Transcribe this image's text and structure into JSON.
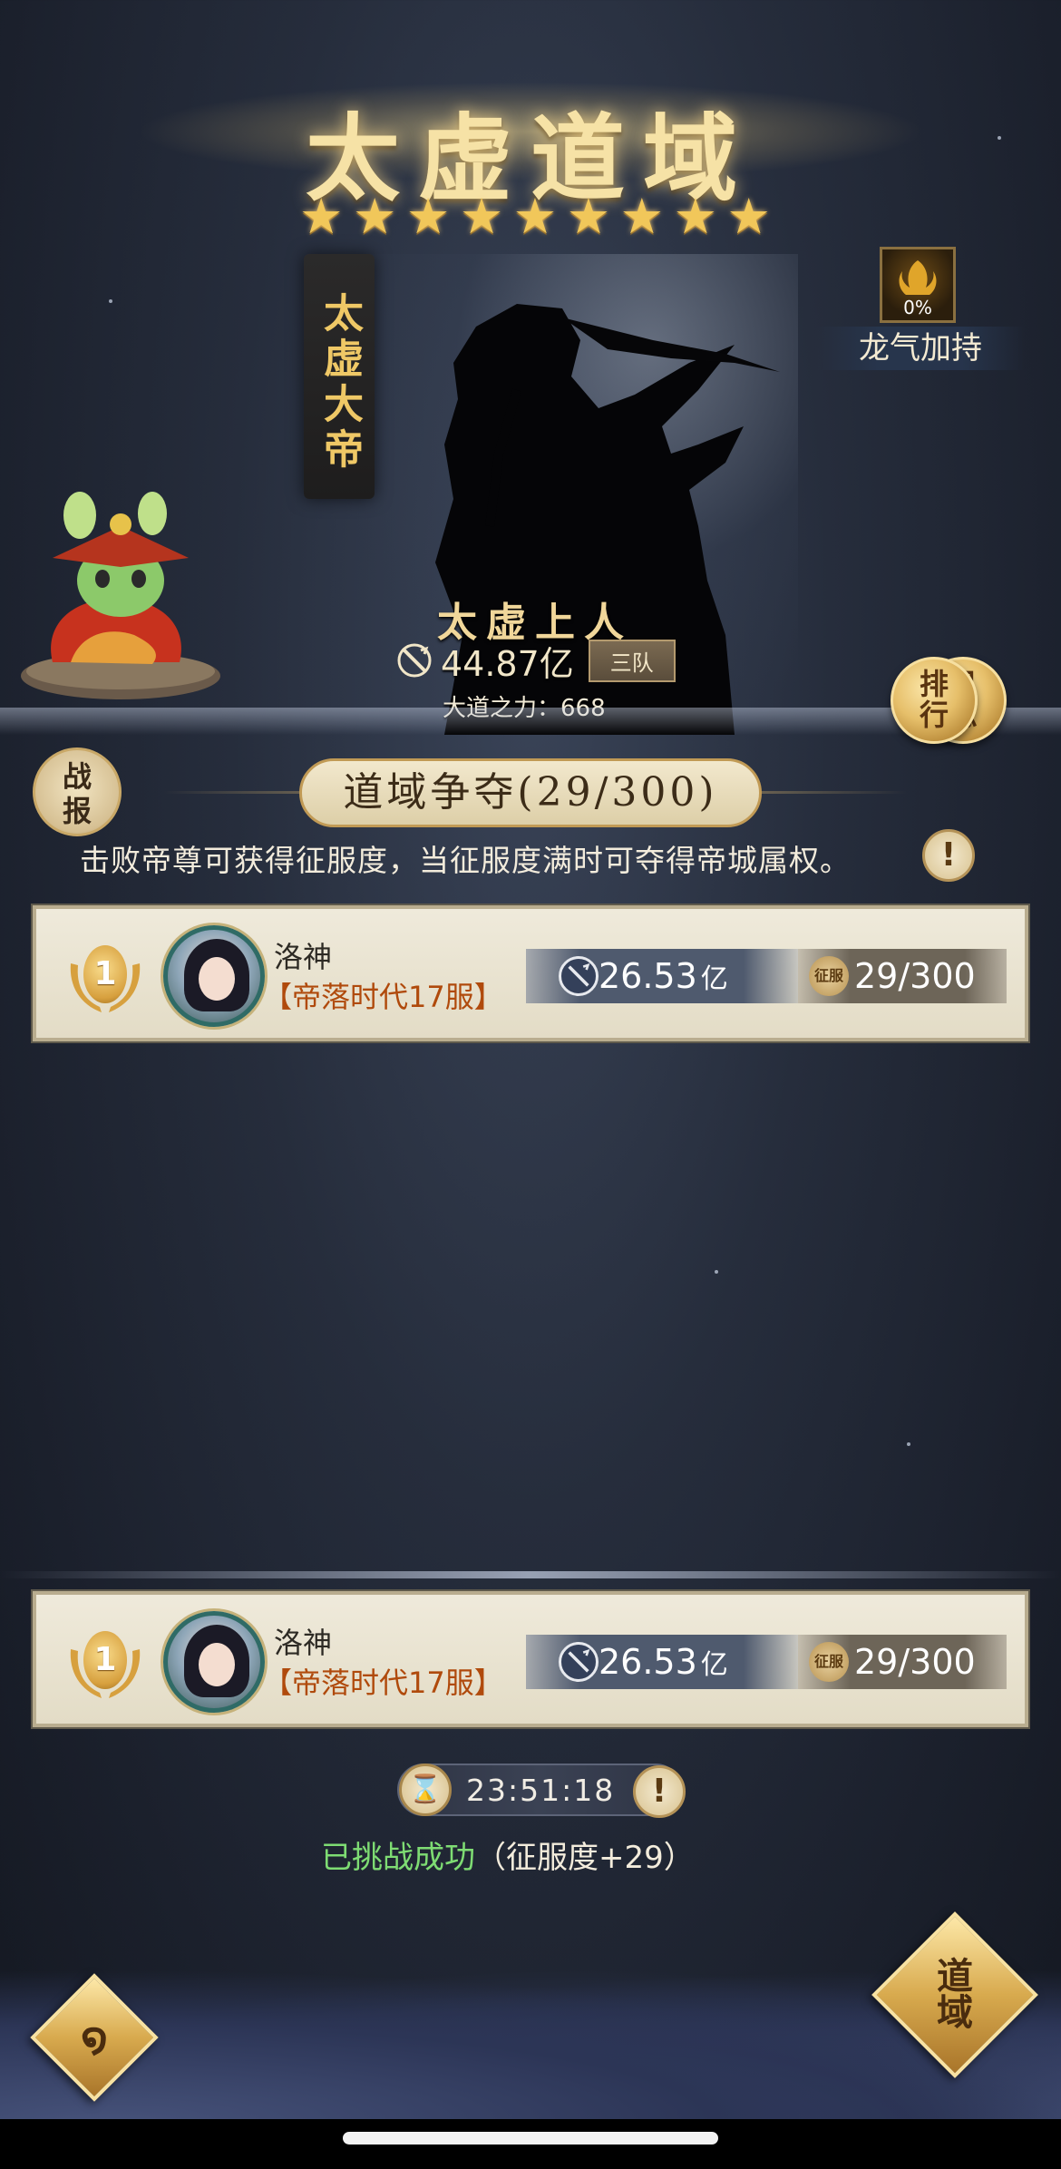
{
  "title": "太虚道域",
  "stars_count": 9,
  "banner_title": "太虚大帝",
  "hero": {
    "name": "太虚上人",
    "power": "44.87亿",
    "team": "三队",
    "dao_power_label": "大道之力：",
    "dao_power_value": "668"
  },
  "buff": {
    "percent": "0%",
    "label": "龙气加持"
  },
  "buttons": {
    "ranking": "排行",
    "log": "日志",
    "battle_report": "战报",
    "dao_domain": "道域"
  },
  "contest": {
    "title": "道域争夺(29/300)",
    "description": "击败帝尊可获得征服度，当征服度满时可夺得帝城属权。"
  },
  "ranking": [
    {
      "rank": "1",
      "name": "洛神",
      "server": "【帝落时代17服】",
      "power": "26.53",
      "power_unit": "亿",
      "conquest_icon": "征服",
      "conquest": "29/300"
    }
  ],
  "my_entry": {
    "rank": "1",
    "name": "洛神",
    "server": "【帝落时代17服】",
    "power": "26.53",
    "power_unit": "亿",
    "conquest_icon": "征服",
    "conquest": "29/300"
  },
  "timer": "23:51:18",
  "challenge_status": {
    "success": "已挑战成功",
    "detail": "（征服度+29）"
  },
  "colors": {
    "gold": "#f1c75a",
    "success_green": "#7edc73",
    "server_orange": "#b04a0c"
  }
}
